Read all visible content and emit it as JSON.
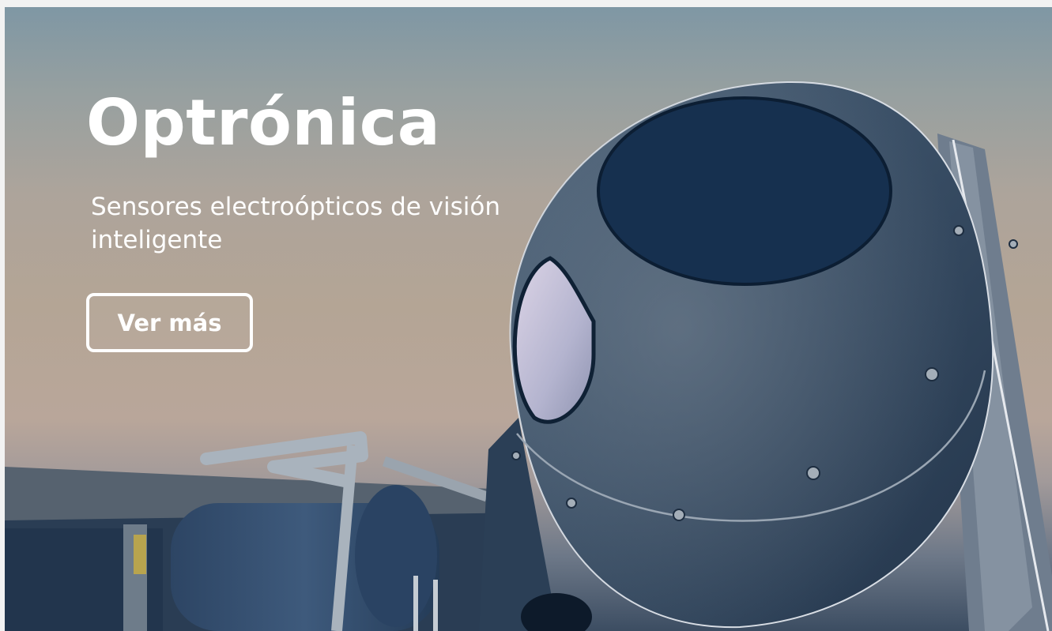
{
  "hero": {
    "title": "Optrónica",
    "subtitle": "Sensores electroópticos de visión inteligente",
    "cta_label": "Ver más"
  },
  "colors": {
    "text": "#ffffff",
    "sky_top": "#7f97a4",
    "sky_mid": "#b4a595",
    "sensor_body": "#364a60",
    "sensor_window": "#173350"
  }
}
